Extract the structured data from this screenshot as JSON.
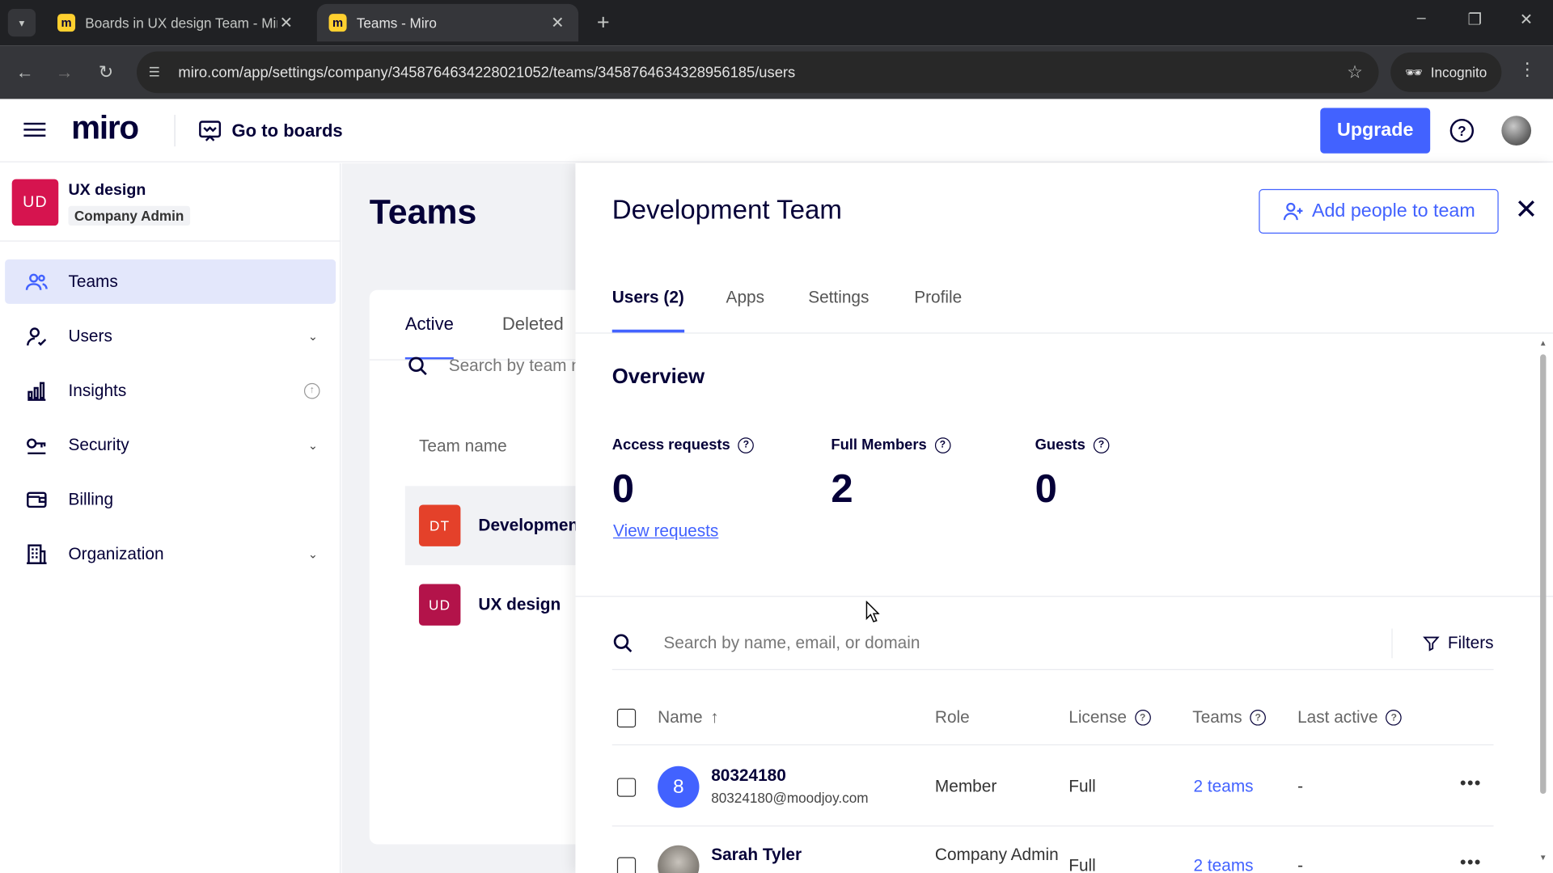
{
  "browser": {
    "tabs": [
      {
        "title": "Boards in UX design Team - Miro",
        "active": false
      },
      {
        "title": "Teams - Miro",
        "active": true
      }
    ],
    "url": "miro.com/app/settings/company/3458764634228021052/teams/3458764634328956185/users",
    "incognito_label": "Incognito"
  },
  "header": {
    "logo": "miro",
    "go_to_boards": "Go to boards",
    "upgrade": "Upgrade"
  },
  "sidebar": {
    "org_initials": "UD",
    "org_name": "UX design",
    "org_role": "Company Admin",
    "items": [
      {
        "label": "Teams",
        "active": true
      },
      {
        "label": "Users",
        "expandable": true
      },
      {
        "label": "Insights",
        "info": true
      },
      {
        "label": "Security",
        "expandable": true
      },
      {
        "label": "Billing"
      },
      {
        "label": "Organization",
        "expandable": true
      }
    ]
  },
  "teams": {
    "title": "Teams",
    "tabs": [
      "Active",
      "Deleted"
    ],
    "search_placeholder": "Search by team name",
    "column_header": "Team name",
    "rows": [
      {
        "initials": "DT",
        "name": "Development Team",
        "color": "#e4412a"
      },
      {
        "initials": "UD",
        "name": "UX design",
        "color": "#b3134a"
      }
    ]
  },
  "panel": {
    "title": "Development Team",
    "add_people": "Add people to team",
    "tabs": [
      "Users (2)",
      "Apps",
      "Settings",
      "Profile"
    ],
    "overview_heading": "Overview",
    "stats": [
      {
        "label": "Access requests",
        "value": "0"
      },
      {
        "label": "Full Members",
        "value": "2"
      },
      {
        "label": "Guests",
        "value": "0"
      }
    ],
    "view_requests": "View requests",
    "search_placeholder": "Search by name, email, or domain",
    "filters": "Filters",
    "columns": {
      "name": "Name",
      "sort_arrow": "↑",
      "role": "Role",
      "license": "License",
      "teams": "Teams",
      "last_active": "Last active"
    },
    "users": [
      {
        "avatar": "8",
        "name": "80324180",
        "email": "80324180@moodjoy.com",
        "role": "Member",
        "license": "Full",
        "teams": "2 teams",
        "last_active": "-"
      },
      {
        "avatar": "",
        "name": "Sarah Tyler",
        "email": "",
        "role": "Company Admin",
        "license": "Full",
        "teams": "2 teams",
        "last_active": "-"
      }
    ]
  },
  "colors": {
    "accent": "#4262ff",
    "org_badge": "#d6144f",
    "active_nav_bg": "#e3e7fb"
  }
}
